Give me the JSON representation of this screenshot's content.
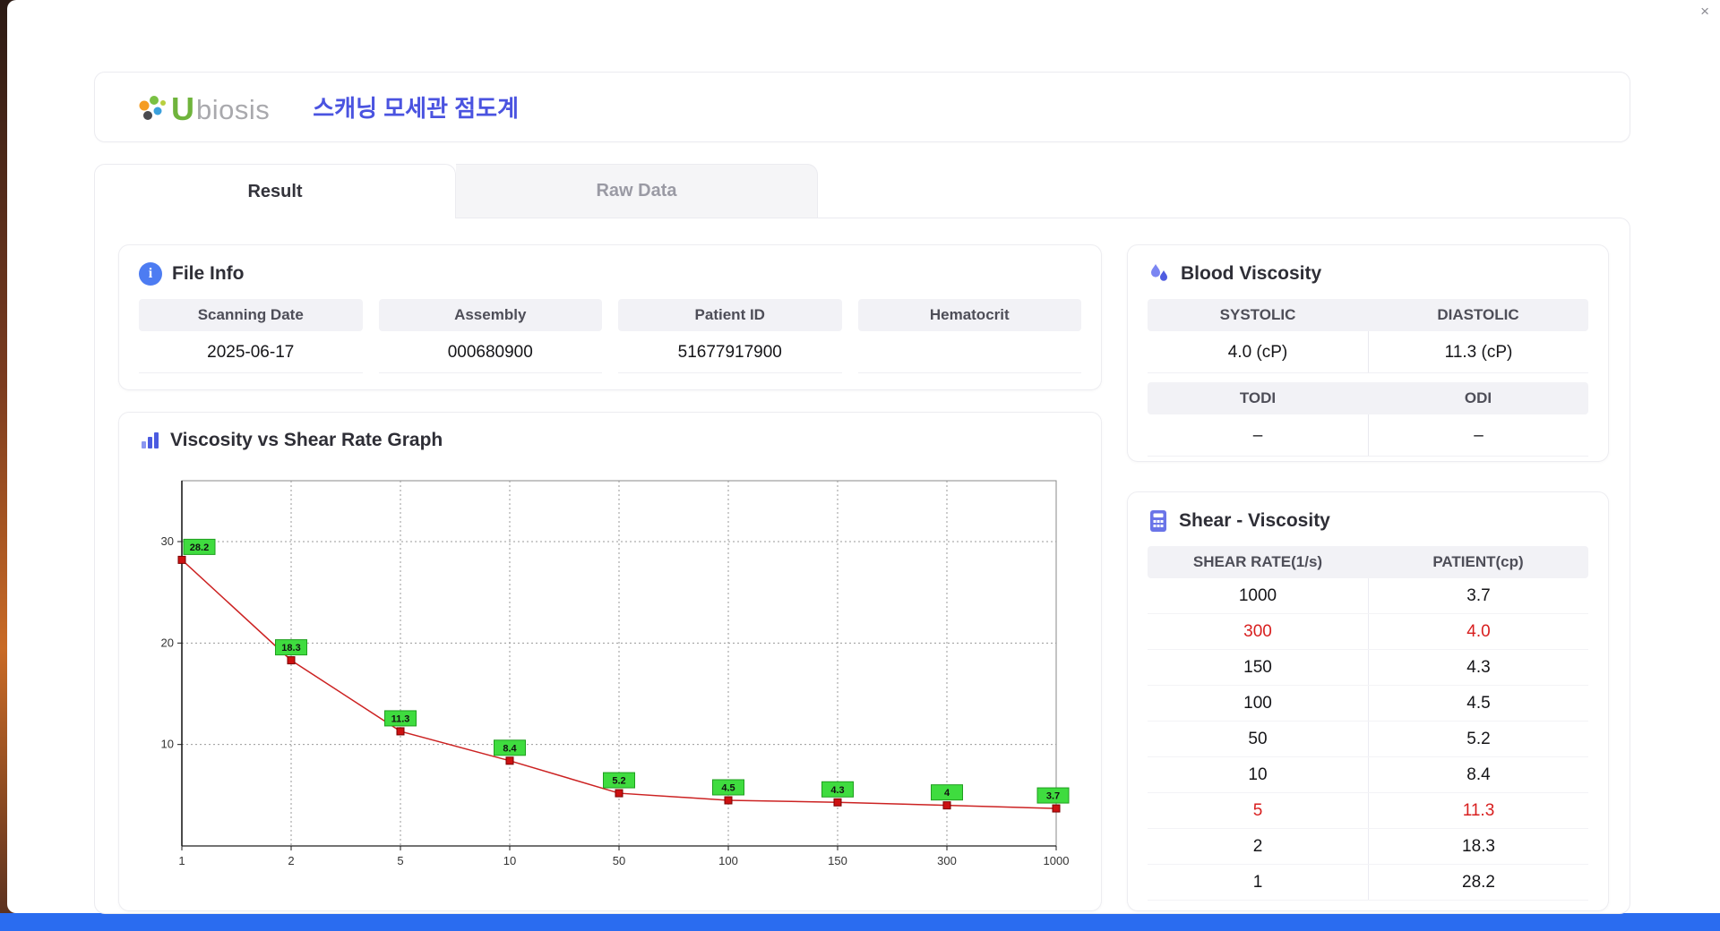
{
  "window": {
    "close_icon": "×"
  },
  "header": {
    "brand_u": "U",
    "brand_rest": "biosis",
    "title": "스캐닝 모세관 점도계"
  },
  "tabs": {
    "result": "Result",
    "raw_data": "Raw Data"
  },
  "file_info": {
    "title": "File Info",
    "info_icon": "i",
    "fields": [
      {
        "label": "Scanning Date",
        "value": "2025-06-17"
      },
      {
        "label": "Assembly",
        "value": "000680900"
      },
      {
        "label": "Patient ID",
        "value": "51677917900"
      },
      {
        "label": "Hematocrit",
        "value": ""
      }
    ]
  },
  "graph_card": {
    "title": "Viscosity vs Shear Rate Graph"
  },
  "blood_viscosity": {
    "title": "Blood Viscosity",
    "systolic_label": "SYSTOLIC",
    "diastolic_label": "DIASTOLIC",
    "systolic_value": "4.0 (cP)",
    "diastolic_value": "11.3 (cP)",
    "todi_label": "TODI",
    "odi_label": "ODI",
    "todi_value": "–",
    "odi_value": "–"
  },
  "shear_table": {
    "title": "Shear - Viscosity",
    "columns": [
      "SHEAR RATE(1/s)",
      "PATIENT(cp)"
    ],
    "rows": [
      {
        "shear": "1000",
        "patient": "3.7",
        "highlight": false
      },
      {
        "shear": "300",
        "patient": "4.0",
        "highlight": true
      },
      {
        "shear": "150",
        "patient": "4.3",
        "highlight": false
      },
      {
        "shear": "100",
        "patient": "4.5",
        "highlight": false
      },
      {
        "shear": "50",
        "patient": "5.2",
        "highlight": false
      },
      {
        "shear": "10",
        "patient": "8.4",
        "highlight": false
      },
      {
        "shear": "5",
        "patient": "11.3",
        "highlight": true
      },
      {
        "shear": "2",
        "patient": "18.3",
        "highlight": false
      },
      {
        "shear": "1",
        "patient": "28.2",
        "highlight": false
      }
    ]
  },
  "chart_data": {
    "type": "line",
    "title": "Viscosity vs Shear Rate Graph",
    "x": [
      1,
      2,
      5,
      10,
      50,
      100,
      150,
      300,
      1000
    ],
    "values": [
      28.2,
      18.3,
      11.3,
      8.4,
      5.2,
      4.5,
      4.3,
      4.0,
      3.7
    ],
    "point_labels": [
      "28.2",
      "18.3",
      "11.3",
      "8.4",
      "5.2",
      "4.5",
      "4.3",
      "4",
      "3.7"
    ],
    "x_scale": "category",
    "xlabel": "",
    "ylabel": "",
    "yticks": [
      10,
      20,
      30
    ],
    "ylim": [
      0,
      36
    ],
    "grid": "dotted",
    "legend": "none",
    "line_color": "#cc2222",
    "marker_color": "#cc1111",
    "label_bg": "#3fdc3f",
    "label_border": "#1f9e1f"
  }
}
